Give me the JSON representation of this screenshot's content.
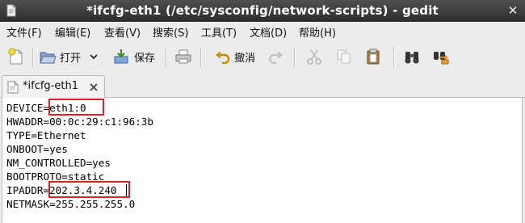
{
  "window": {
    "title": "*ifcfg-eth1 (/etc/sysconfig/network-scripts) - gedit",
    "close_glyph": "✕"
  },
  "menu": [
    {
      "label": "文件(F)"
    },
    {
      "label": "编辑(E)"
    },
    {
      "label": "查看(V)"
    },
    {
      "label": "搜索(S)"
    },
    {
      "label": "工具(T)"
    },
    {
      "label": "文档(D)"
    },
    {
      "label": "帮助(H)"
    }
  ],
  "toolbar": {
    "new_icon": "new-document-icon",
    "open_label": "打开",
    "open_menu_icon": "chevron-down-icon",
    "save_label": "保存",
    "print_icon": "printer-icon",
    "undo_label": "撤消",
    "redo_icon": "redo-icon",
    "cut_icon": "scissors-icon",
    "copy_icon": "copy-icon",
    "paste_icon": "clipboard-icon",
    "find_icon": "binoculars-icon",
    "replace_icon": "find-replace-icon"
  },
  "tab": {
    "label": "*ifcfg-eth1",
    "close_icon": "close-icon"
  },
  "editor": {
    "lines": [
      "DEVICE=eth1:0",
      "HWADDR=00:0c:29:c1:96:3b",
      "TYPE=Ethernet",
      "ONBOOT=yes",
      "NM_CONTROLLED=yes",
      "BOOTPROTO=static",
      "IPADDR=202.3.4.240",
      "NETMASK=255.255.255.0"
    ],
    "highlight_color": "#e0202a"
  }
}
